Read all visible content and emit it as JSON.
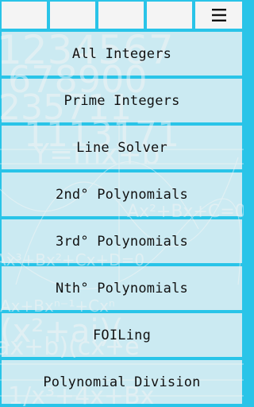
{
  "toolbar": {
    "menu_icon": "hamburger-menu-icon"
  },
  "menu": {
    "items": [
      {
        "label": "All Integers"
      },
      {
        "label": "Prime Integers"
      },
      {
        "label": "Line Solver"
      },
      {
        "label": "2nd° Polynomials"
      },
      {
        "label": "3rd° Polynomials"
      },
      {
        "label": "Nth° Polynomials"
      },
      {
        "label": "FOILing"
      },
      {
        "label": "Polynomial Division"
      }
    ]
  },
  "colors": {
    "accent": "#29c4e8",
    "button_bg": "#f4f4f4",
    "text": "#111111"
  }
}
